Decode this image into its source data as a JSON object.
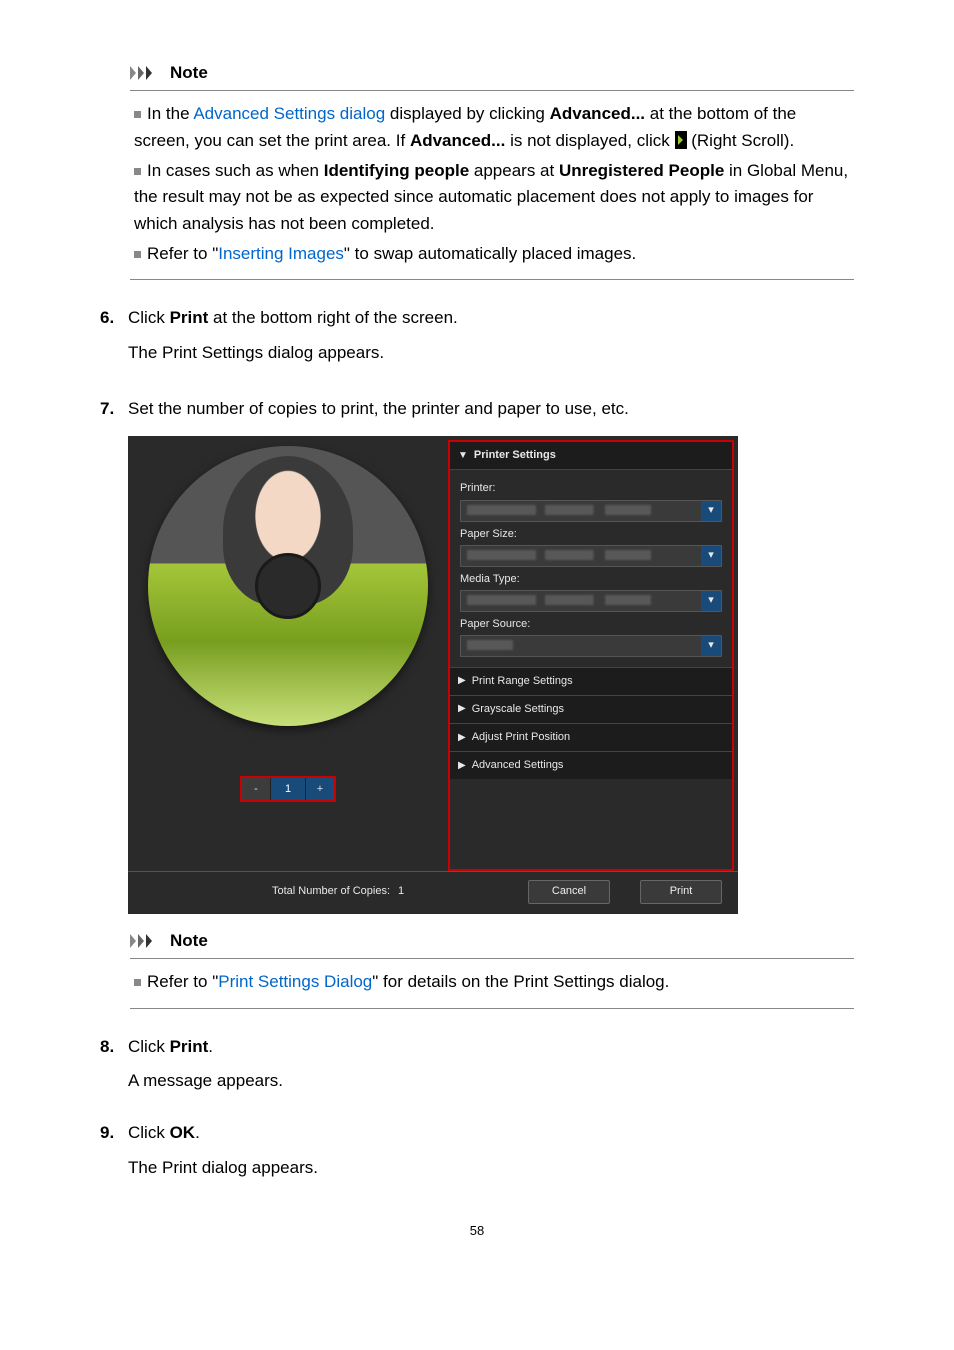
{
  "note1": {
    "title": "Note",
    "bullet1_pre": "In the ",
    "bullet1_link": "Advanced Settings dialog",
    "bullet1_mid": " displayed by clicking ",
    "bullet1_bold1": "Advanced...",
    "bullet1_mid2": " at the bottom of the screen, you can set the print area. If ",
    "bullet1_bold2": "Advanced...",
    "bullet1_mid3": " is not displayed, click ",
    "bullet1_after_icon": " (Right Scroll).",
    "bullet2_pre": "In cases such as when ",
    "bullet2_bold1": "Identifying people",
    "bullet2_mid": " appears at ",
    "bullet2_bold2": "Unregistered People",
    "bullet2_post": " in Global Menu, the result may not be as expected since automatic placement does not apply to images for which analysis has not been completed.",
    "bullet3_pre": "Refer to \"",
    "bullet3_link": "Inserting Images",
    "bullet3_post": "\" to swap automatically placed images."
  },
  "step6": {
    "num": "6.",
    "pre": "Click ",
    "bold": "Print",
    "post": " at the bottom right of the screen.",
    "sub": "The Print Settings dialog appears."
  },
  "step7": {
    "num": "7.",
    "text": "Set the number of copies to print, the printer and paper to use, etc."
  },
  "dialog": {
    "printer_settings": "Printer Settings",
    "printer": "Printer:",
    "paper_size": "Paper Size:",
    "media_type": "Media Type:",
    "paper_source": "Paper Source:",
    "print_range": "Print Range Settings",
    "grayscale": "Grayscale Settings",
    "adjust_pos": "Adjust Print Position",
    "advanced": "Advanced Settings",
    "copies_value": "1",
    "minus": "-",
    "plus": "+",
    "total_label": "Total Number of Copies:",
    "total_value": "1",
    "cancel": "Cancel",
    "print": "Print"
  },
  "note2": {
    "title": "Note",
    "pre": "Refer to \"",
    "link": "Print Settings Dialog",
    "post": "\" for details on the Print Settings dialog."
  },
  "step8": {
    "num": "8.",
    "pre": "Click ",
    "bold": "Print",
    "post": ".",
    "sub": "A message appears."
  },
  "step9": {
    "num": "9.",
    "pre": "Click ",
    "bold": "OK",
    "post": ".",
    "sub": "The Print dialog appears."
  },
  "page_number": "58"
}
